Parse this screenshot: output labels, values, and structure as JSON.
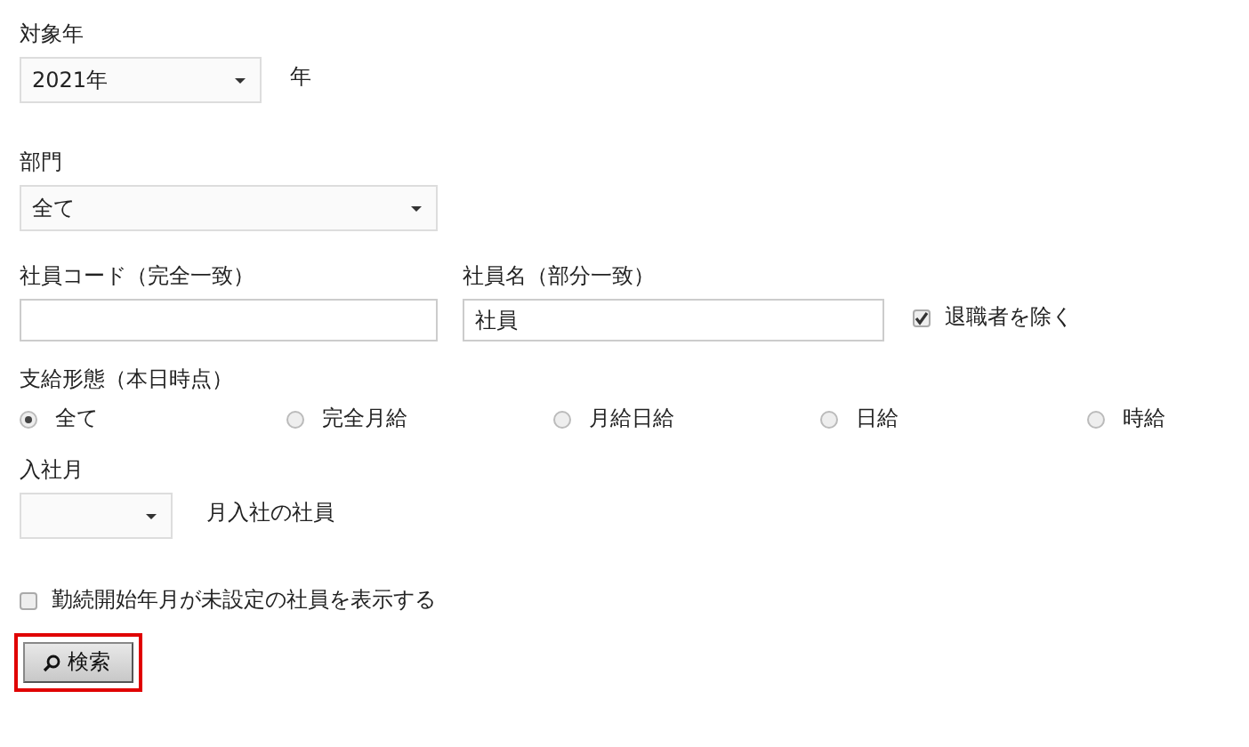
{
  "target_year": {
    "label": "対象年",
    "value": "2021年",
    "suffix": "年"
  },
  "department": {
    "label": "部門",
    "value": "全て"
  },
  "employee_code": {
    "label": "社員コード（完全一致）"
  },
  "employee_name": {
    "label": "社員名（部分一致）",
    "value": "社員"
  },
  "exclude_retired": {
    "label": "退職者を除く",
    "checked": true
  },
  "pay_type": {
    "label": "支給形態（本日時点）",
    "options": [
      {
        "label": "全て",
        "selected": true
      },
      {
        "label": "完全月給",
        "selected": false
      },
      {
        "label": "月給日給",
        "selected": false
      },
      {
        "label": "日給",
        "selected": false
      },
      {
        "label": "時給",
        "selected": false
      }
    ]
  },
  "hire_month": {
    "label": "入社月",
    "suffix": "月入社の社員"
  },
  "show_unset_start": {
    "label": "勤続開始年月が未設定の社員を表示する",
    "checked": false
  },
  "search_button": {
    "label": "検索",
    "highlighted": true
  }
}
